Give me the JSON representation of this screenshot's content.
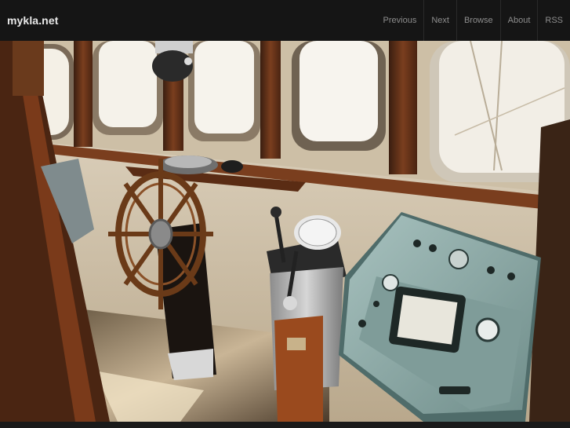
{
  "site": {
    "title": "mykla.net"
  },
  "nav": {
    "items": [
      {
        "label": "Previous"
      },
      {
        "label": "Next"
      },
      {
        "label": "Browse"
      },
      {
        "label": "About"
      },
      {
        "label": "RSS"
      }
    ]
  },
  "photo": {
    "subject": "ship-bridge-interior"
  },
  "colors": {
    "header_bg": "#151515",
    "logo": "#e8e8e8",
    "nav_text": "#8d8d8d"
  }
}
